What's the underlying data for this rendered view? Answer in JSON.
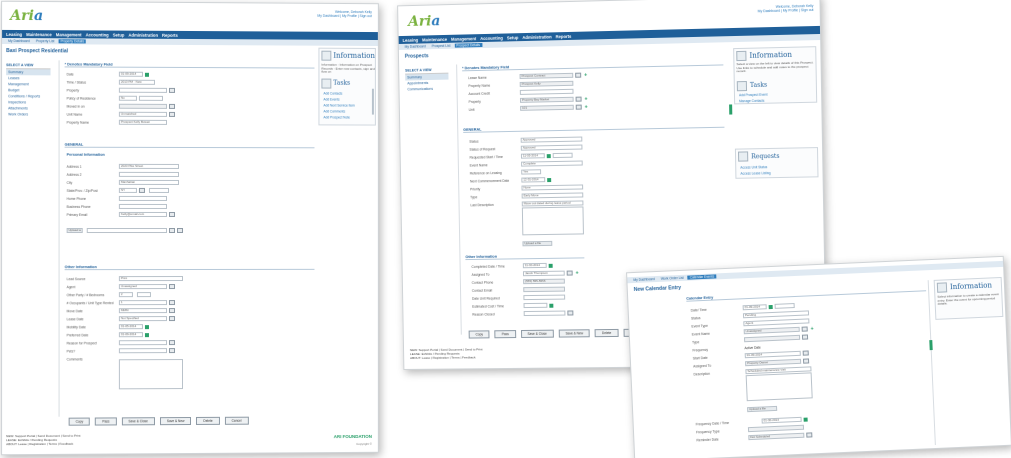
{
  "colors": {
    "brand_blue": "#1f5f99",
    "brand_green": "#7cb342",
    "accent_green": "#2aa06a"
  },
  "app": {
    "logo_main": "Ari",
    "logo_accent": "a"
  },
  "header": {
    "welcome": "Welcome, Deborah Kelly",
    "links": "My Dashboard | My Profile | Sign out"
  },
  "nav": [
    "Leasing",
    "Maintenance",
    "Management",
    "Accounting",
    "Setup",
    "Administration",
    "Reports"
  ],
  "screen1": {
    "subnav": [
      "My Dashboard",
      "Property List",
      "Property Details"
    ],
    "title": "Baxi Prospect Residential",
    "leftnav_header": "SELECT A VIEW",
    "leftnav": [
      "Summary",
      "Leases",
      "Management",
      "Budget",
      "Conditions / Reports",
      "Inspections",
      "Attachments",
      "Work Orders"
    ],
    "section1": "* Denotes Mandatory Field",
    "fields1": [
      {
        "label": "Date",
        "value": "01-09-2014"
      },
      {
        "label": "Time / Status",
        "value": "2013 PM · New"
      },
      {
        "label": "Property",
        "value": ""
      },
      {
        "label": "Policy of Residence",
        "value": "No"
      },
      {
        "label": "Moved in on",
        "value": ""
      },
      {
        "label": "Unit Name",
        "value": "Unmatched"
      },
      {
        "label": "Property Name",
        "value": "Prospect Kelly Bowen"
      }
    ],
    "section2": "GENERAL",
    "section2b": "Personal Information",
    "fields2": [
      {
        "label": "Address 1",
        "value": "2023 Pike Street"
      },
      {
        "label": "Address 2",
        "value": ""
      },
      {
        "label": "City",
        "value": "Manhattan"
      },
      {
        "label": "State/Prov. / Zip/Post",
        "value": "NY"
      },
      {
        "label": "Home Phone",
        "value": ""
      },
      {
        "label": "Business Phone",
        "value": ""
      },
      {
        "label": "Primary Email",
        "value": "Kelly@email.com"
      }
    ],
    "upload_label": "Upload a file",
    "section3": "Other Information",
    "fields3": [
      {
        "label": "Lead Source",
        "value": "Print"
      },
      {
        "label": "Agent",
        "value": "Unassigned"
      },
      {
        "label": "Other Party / # Bedrooms",
        "value": "2"
      },
      {
        "label": "# Occupants / Unit Type Rented",
        "value": "1"
      },
      {
        "label": "Move Date",
        "value": "MMM"
      },
      {
        "label": "Lease Date",
        "value": "Not Specified"
      },
      {
        "label": "Mobility Date",
        "value": "01-05-2014"
      },
      {
        "label": "Preferred Date",
        "value": "01-09-2014"
      },
      {
        "label": "Reason for Prospect",
        "value": ""
      },
      {
        "label": "Pets?",
        "value": ""
      },
      {
        "label": "Comments",
        "value": ""
      }
    ],
    "buttons": [
      "Copy",
      "Pass",
      "Save & Close",
      "Save & New",
      "Delete",
      "Cancel"
    ],
    "footer": [
      "NEW: Support Portal | Send Document | Send to Print",
      "LEASE: Exhibits / Pending Requests",
      "ABOUT: Lease | Registration | Terms | Feedback"
    ],
    "footer_logo": "ARI FOUNDATION",
    "footer_copyright": "Copyright ©",
    "info_title": "Information",
    "info_text": "Information - Information on Prospect Records - Enter new contacts, sign and flow on",
    "tasks_title": "Tasks",
    "tasks": [
      "Add Contacts",
      "Add Events",
      "Add Next Service Item",
      "Add Comments",
      "Add Prospect Note"
    ]
  },
  "screen2": {
    "subnav": [
      "My Dashboard",
      "Prospect List",
      "Prospect Details"
    ],
    "title": "Prospects",
    "leftnav_header": "SELECT A VIEW",
    "leftnav": [
      "Summary",
      "Appointments",
      "Communications"
    ],
    "section1": "* Denotes Mandatory Field",
    "fields1": [
      {
        "label": "Lease Name",
        "value": "Prospect Contract"
      },
      {
        "label": "Property Name",
        "value": "Prospect Kelly"
      },
      {
        "label": "Account Credit",
        "value": ""
      },
      {
        "label": "Property",
        "value": "Property Bay Market"
      },
      {
        "label": "Unit",
        "value": "101"
      }
    ],
    "section2": "GENERAL",
    "fields2": [
      {
        "label": "Status",
        "value": "Approved"
      },
      {
        "label": "Status of Request",
        "value": "Approved"
      },
      {
        "label": "Requested Start / Time",
        "value": "11-05-2014"
      },
      {
        "label": "Event Name",
        "value": "Complete"
      },
      {
        "label": "Reference on Leasing",
        "value": "Yes"
      },
      {
        "label": "Next Commencement Date",
        "value": "12-31-2014"
      },
      {
        "label": "Priority",
        "value": "None"
      },
      {
        "label": "Type",
        "value": "Early Move"
      },
      {
        "label": "Last Description",
        "value": "Move out dated during lease period"
      }
    ],
    "upload_label": "Upload a file",
    "section3": "Other Information",
    "fields3": [
      {
        "label": "Completed Date / Time",
        "value": "11-30-2014"
      },
      {
        "label": "Assigned To",
        "value": "Jacob Thompson"
      },
      {
        "label": "Contact Phone",
        "value": "(555) 555-5555"
      },
      {
        "label": "Contact Email",
        "value": ""
      },
      {
        "label": "Date Unit Required",
        "value": ""
      },
      {
        "label": "Estimated Cost / Time",
        "value": ""
      },
      {
        "label": "Reason Closed",
        "value": ""
      }
    ],
    "buttons": [
      "Copy",
      "Pass",
      "Save & Close",
      "Save & New",
      "Delete",
      "Cancel"
    ],
    "footer": [
      "NEW: Support Portal | Send Document | Send to Print",
      "LEASE: Exhibits / Pending Requests",
      "ABOUT: Lease | Registration | Terms | Feedback"
    ],
    "info_title": "Information",
    "info_text": "Select a view on the left to view details of this Prospect. Use links to schedule and add notes to the prospect record.",
    "tasks_title": "Tasks",
    "tasks": [
      "Add Prospect Event",
      "Manage Contacts"
    ],
    "requests_title": "Requests",
    "requests": [
      "Access Unit Status",
      "Access Lease Listing"
    ]
  },
  "screen3": {
    "subnav": [
      "My Dashboard",
      "Work Order List",
      "Calendar Events"
    ],
    "title": "New Calendar Entry",
    "section1": "Calendar Entry",
    "fields": [
      {
        "label": "Date/ Time",
        "value": "01-09-2014"
      },
      {
        "label": "Status",
        "value": "Pending"
      },
      {
        "label": "Event Type",
        "value": "Agent"
      },
      {
        "label": "Event Name",
        "value": "Unassigned"
      },
      {
        "label": "Type",
        "value": ""
      },
      {
        "label": "Frequency",
        "value": "Active Date"
      },
      {
        "label": "Start Date",
        "value": "01-09-2014"
      },
      {
        "label": "Assigned To",
        "value": "Property Owner"
      },
      {
        "label": "Description",
        "value": "Scheduled maintenance visit"
      }
    ],
    "upload_label": "Upload a file",
    "fields_b": [
      {
        "label": "Frequency Date / Time",
        "value": "01-30-2014"
      },
      {
        "label": "Frequency Type",
        "value": ""
      },
      {
        "label": "Reminder Date",
        "value": "Not Scheduled"
      }
    ],
    "info_title": "Information",
    "info_text": "Select information to create a calendar event entry. Enter the event for upcoming period details."
  }
}
